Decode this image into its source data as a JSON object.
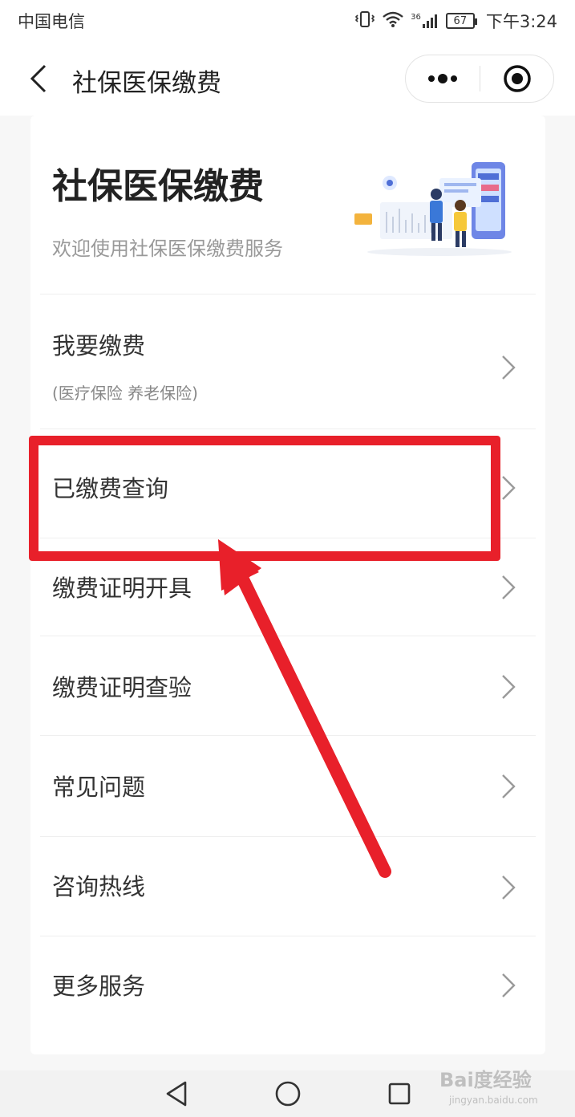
{
  "status_bar": {
    "carrier": "中国电信",
    "network": "36",
    "battery": "67",
    "time": "下午3:24"
  },
  "nav": {
    "title": "社保医保缴费",
    "more_icon": "more-dots-icon",
    "close_icon": "target-icon"
  },
  "header": {
    "title": "社保医保缴费",
    "subtitle": "欢迎使用社保医保缴费服务"
  },
  "menu": [
    {
      "label": "我要缴费",
      "sub": "(医疗保险 养老保险)"
    },
    {
      "label": "已缴费查询"
    },
    {
      "label": "缴费证明开具"
    },
    {
      "label": "缴费证明查验"
    },
    {
      "label": "常见问题"
    },
    {
      "label": "咨询热线"
    },
    {
      "label": "更多服务"
    }
  ],
  "annotation": {
    "highlight_color": "#e8202a",
    "highlighted_item": "已缴费查询"
  },
  "watermark": {
    "text": "Bai度经验",
    "url": "jingyan.baidu.com"
  }
}
